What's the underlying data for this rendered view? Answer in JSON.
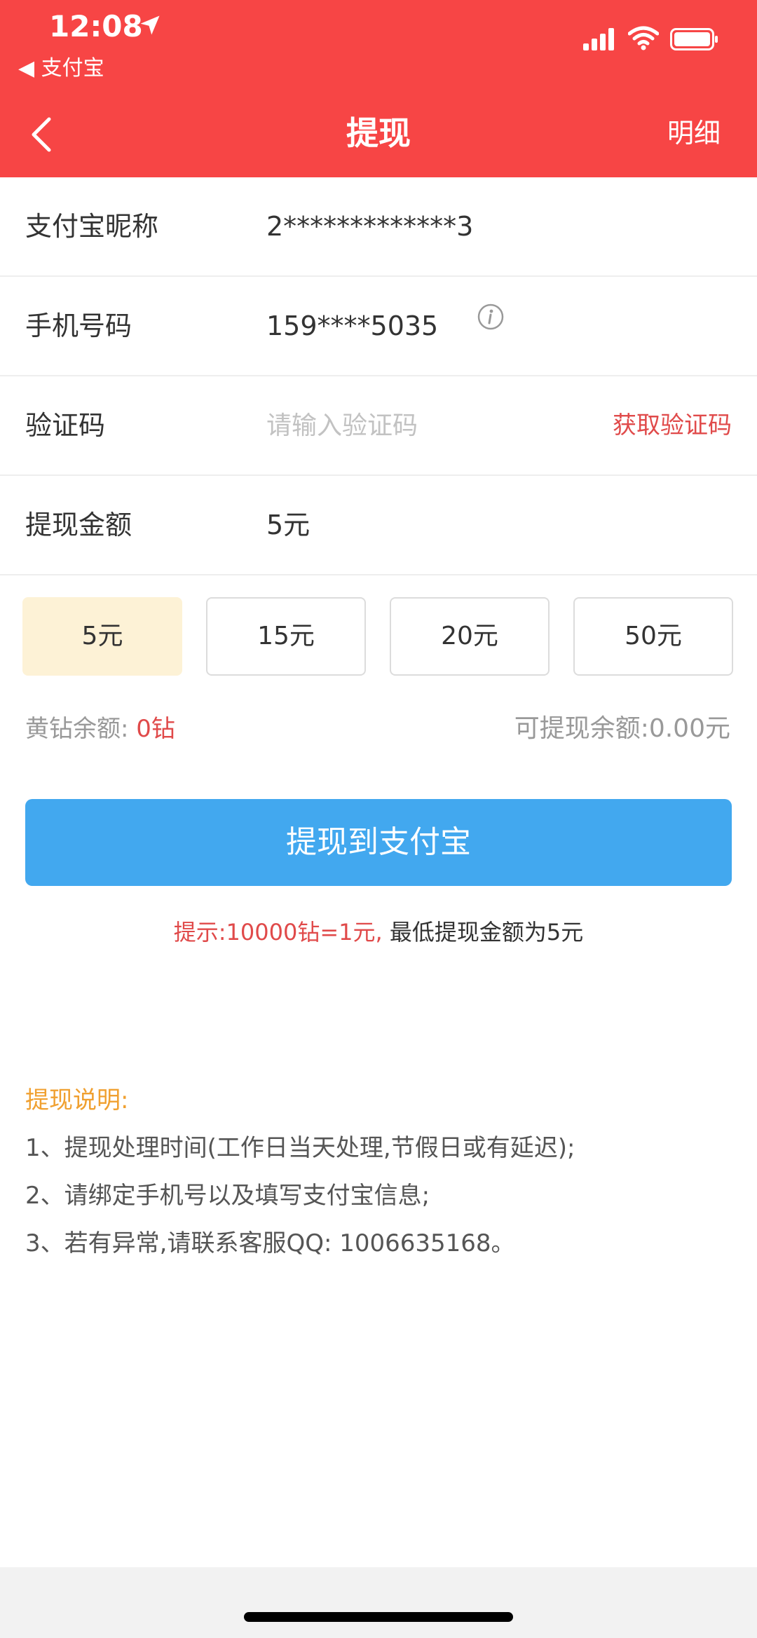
{
  "status_bar": {
    "time": "12:08",
    "back_app": "◀ 支付宝"
  },
  "nav": {
    "title": "提现",
    "detail": "明细"
  },
  "form": {
    "nickname_label": "支付宝昵称",
    "nickname_value": "2*************3",
    "phone_label": "手机号码",
    "phone_value": "159****5035",
    "code_label": "验证码",
    "code_placeholder": "请输入验证码",
    "get_code": "获取验证码",
    "amount_label": "提现金额",
    "amount_value": "5元"
  },
  "amount_options": [
    {
      "label": "5元",
      "selected": true
    },
    {
      "label": "15元",
      "selected": false
    },
    {
      "label": "20元",
      "selected": false
    },
    {
      "label": "50元",
      "selected": false
    }
  ],
  "balance": {
    "diamond_label": "黄钻余额:",
    "diamond_value": "0钻",
    "withdrawable": "可提现余额:0.00元"
  },
  "submit_label": "提现到支付宝",
  "tip": {
    "red_part": "提示:10000钻=1元,",
    "normal_part": "最低提现金额为5元"
  },
  "description": {
    "title": "提现说明:",
    "lines": [
      "1、提现处理时间(工作日当天处理,节假日或有延迟);",
      "2、请绑定手机号以及填写支付宝信息;",
      "3、若有异常,请联系客服QQ: 1006635168。"
    ]
  },
  "colors": {
    "header": "#f74545",
    "button": "#42a8ef",
    "selected_amount": "#fdf2d6",
    "accent_red": "#e04a4a",
    "desc_title": "#f0a030"
  }
}
